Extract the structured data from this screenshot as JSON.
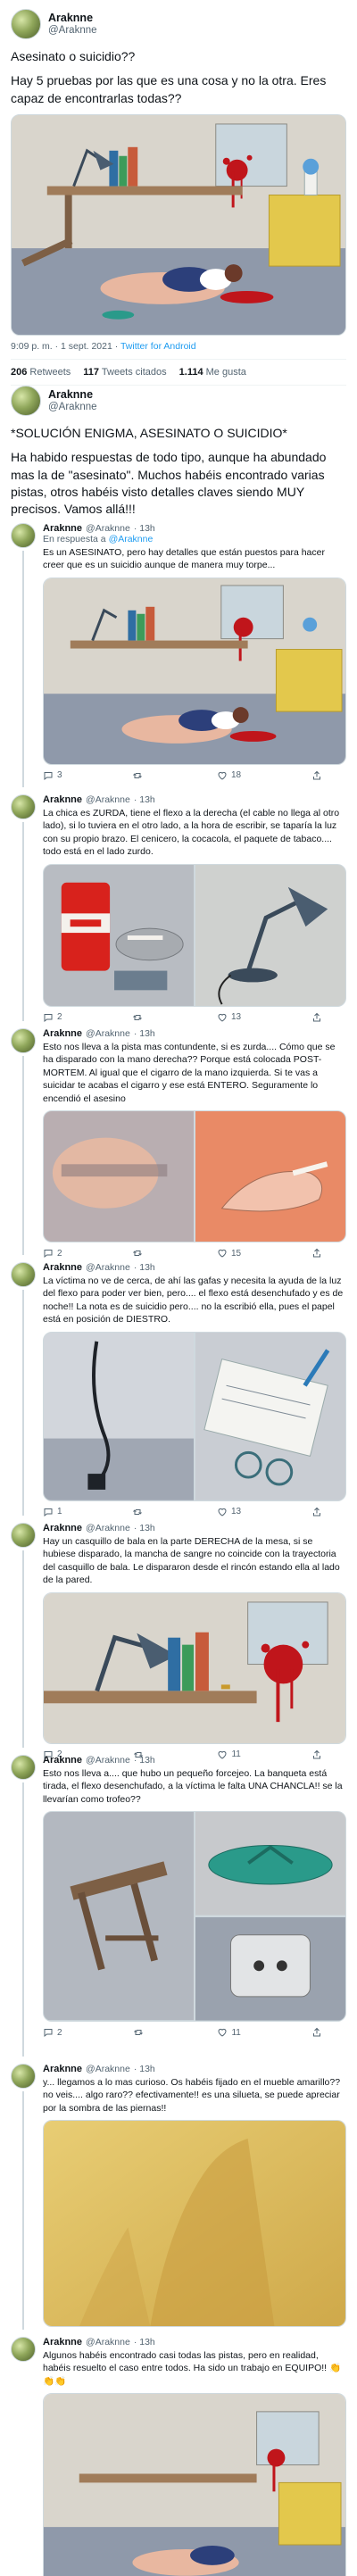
{
  "tweet1": {
    "name": "Araknne",
    "handle": "@Araknne",
    "text1": "Asesinato o suicidio??",
    "text2": "Hay 5 pruebas por las que es una cosa y no la otra. Eres capaz de encontrarlas todas??",
    "time": "9:09 p. m. · 1 sept. 2021 ·",
    "client": "Twitter for Android",
    "retweets_count": "206",
    "retweets_label": "Retweets",
    "quotes_count": "117",
    "quotes_label": "Tweets citados",
    "likes_count": "1.114",
    "likes_label": "Me gusta"
  },
  "tweet2": {
    "name": "Araknne",
    "handle": "@Araknne",
    "text1": "*SOLUCIÓN ENIGMA, ASESINATO O SUICIDIO*",
    "text2": "Ha habido respuestas de todo tipo, aunque ha abundado mas la de \"asesinato\". Muchos habéis encontrado varias pistas, otros habéis visto detalles claves siendo MUY precisos. Vamos allá!!!"
  },
  "replies": [
    {
      "name": "Araknne",
      "handle": "@Araknne",
      "time": "· 13h",
      "reply_prefix": "En respuesta a",
      "reply_to": "@Araknne",
      "text": "Es un ASESINATO, pero hay detalles que están puestos para hacer creer que es un suicidio aunque de manera muy torpe...",
      "replies": "3",
      "retweets": "",
      "likes": "18"
    },
    {
      "name": "Araknne",
      "handle": "@Araknne",
      "time": "· 13h",
      "text": "La chica es ZURDA, tiene el flexo a la derecha (el cable no llega al otro lado), si lo tuviera en el otro lado, a la hora de escribir, se taparía la luz con su propio brazo. El cenicero, la cocacola, el paquete de tabaco.... todo está en el lado zurdo.",
      "replies": "2",
      "retweets": "",
      "likes": "13"
    },
    {
      "name": "Araknne",
      "handle": "@Araknne",
      "time": "· 13h",
      "text": "Esto nos lleva a la pista mas contundente, si es zurda.... Cómo que se ha disparado con la mano derecha?? Porque está colocada POST-MORTEM. Al igual que el cigarro de la mano izquierda. Si te vas a suicidar te acabas el cigarro y ese está ENTERO. Seguramente lo encendió el asesino",
      "replies": "2",
      "retweets": "",
      "likes": "15"
    },
    {
      "name": "Araknne",
      "handle": "@Araknne",
      "time": "· 13h",
      "text": "La víctima no ve de cerca, de ahí las gafas y necesita la ayuda de la luz del flexo para poder ver bien, pero.... el flexo está desenchufado y es de noche!! La nota es de suicidio pero.... no la escribió ella, pues el papel está en posición de DIESTRO.",
      "replies": "1",
      "retweets": "",
      "likes": "13"
    },
    {
      "name": "Araknne",
      "handle": "@Araknne",
      "time": "· 13h",
      "text": "Hay un casquillo de bala en la parte DERECHA de la mesa, si se hubiese disparado, la mancha de sangre no coincide con la trayectoria del casquillo de bala. Le dispararon desde el rincón estando ella al lado de la pared.",
      "replies": "2",
      "retweets": "",
      "likes": "11"
    },
    {
      "name": "Araknne",
      "handle": "@Araknne",
      "time": "· 13h",
      "text": "Esto nos lleva a.... que hubo un pequeño forcejeo. La banqueta está tirada, el flexo desenchufado, a la víctima le falta UNA CHANCLA!! se la llevarían como trofeo??",
      "replies": "2",
      "retweets": "",
      "likes": "11"
    },
    {
      "name": "Araknne",
      "handle": "@Araknne",
      "time": "· 13h",
      "text": "y... llegamos a lo mas curioso. Os habéis fijado en el mueble amarillo?? no veis.... algo raro?? efectivamente!! es una silueta, se puede apreciar por la sombra de las piernas!!",
      "replies": "",
      "retweets": "",
      "likes": ""
    },
    {
      "name": "Araknne",
      "handle": "@Araknne",
      "time": "· 13h",
      "text": "Algunos habéis encontrado casi todas las pistas, pero en realidad, habéis resuelto el caso entre todos. Ha sido un trabajo en EQUIPO!! 👏👏👏",
      "replies": "",
      "retweets": "",
      "likes": ""
    }
  ],
  "colors": {
    "link": "#1d9bf0",
    "muted": "#536471",
    "border": "#cfd9de",
    "blood": "#c0151b"
  }
}
